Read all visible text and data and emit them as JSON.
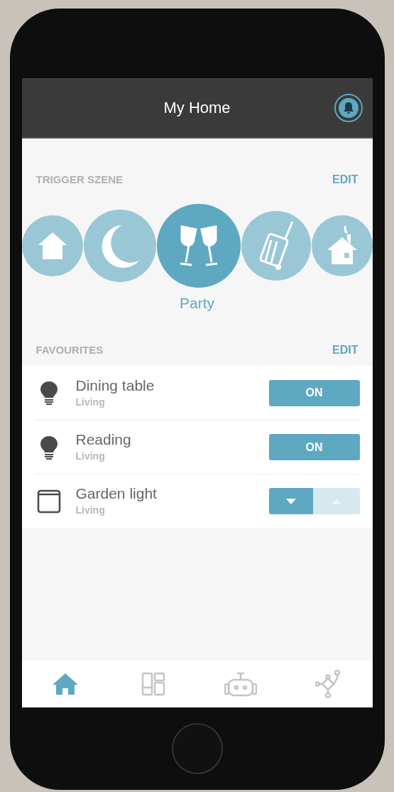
{
  "header": {
    "title": "My Home"
  },
  "scenes_section": {
    "title": "TRIGGER SZENE",
    "action": "EDIT"
  },
  "scenes": [
    {
      "kind": "home",
      "selected": false
    },
    {
      "kind": "moon",
      "selected": false
    },
    {
      "kind": "glasses",
      "selected": true,
      "label": "Party"
    },
    {
      "kind": "suitcase",
      "selected": false
    },
    {
      "kind": "house-smoke",
      "selected": false
    }
  ],
  "favourites_section": {
    "title": "FAVOURITES",
    "action": "EDIT"
  },
  "favourites": [
    {
      "kind": "bulb",
      "name": "Dining table",
      "room": "Living",
      "control": {
        "kind": "switch",
        "label": "ON",
        "on": true
      }
    },
    {
      "kind": "bulb",
      "name": "Reading",
      "room": "Living",
      "control": {
        "kind": "switch",
        "label": "ON",
        "on": true
      }
    },
    {
      "kind": "blind",
      "name": "Garden light",
      "room": "Living",
      "control": {
        "kind": "updown",
        "down_enabled": true,
        "up_enabled": false
      }
    }
  ],
  "tabs": [
    {
      "kind": "home",
      "selected": true
    },
    {
      "kind": "rooms",
      "selected": false
    },
    {
      "kind": "robot",
      "selected": false
    },
    {
      "kind": "network",
      "selected": false
    }
  ]
}
